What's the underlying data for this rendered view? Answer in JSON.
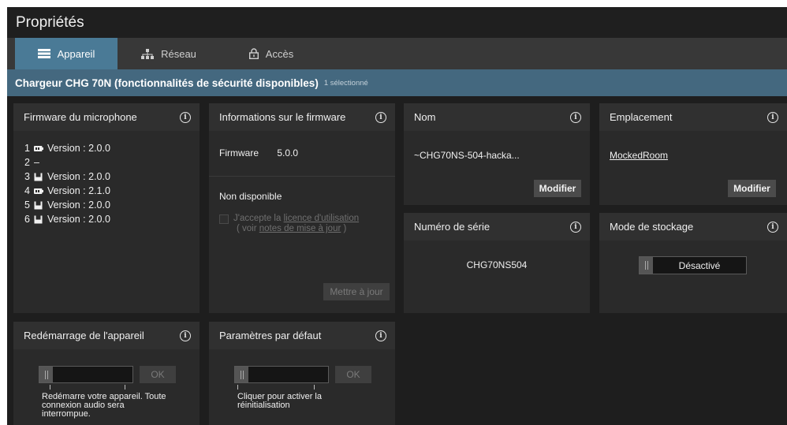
{
  "window": {
    "title": "Propriétés"
  },
  "tabs": [
    {
      "label": "Appareil",
      "icon": "device-icon",
      "active": true
    },
    {
      "label": "Réseau",
      "icon": "network-icon",
      "active": false
    },
    {
      "label": "Accès",
      "icon": "lock-icon",
      "active": false
    }
  ],
  "device": {
    "title": "Chargeur CHG 70N (fonctionnalités de sécurité disponibles)",
    "selected": "1 sélectionné"
  },
  "firmware_mic": {
    "title": "Firmware du microphone",
    "rows": [
      {
        "num": "1",
        "icon": "battery-pack-icon",
        "text": "Version : 2.0.0"
      },
      {
        "num": "2",
        "icon": "",
        "text": "–"
      },
      {
        "num": "3",
        "icon": "handheld-mic-icon",
        "text": "Version : 2.0.0"
      },
      {
        "num": "4",
        "icon": "battery-pack-icon",
        "text": "Version : 2.1.0"
      },
      {
        "num": "5",
        "icon": "handheld-mic-icon",
        "text": "Version : 2.0.0"
      },
      {
        "num": "6",
        "icon": "handheld-mic-icon",
        "text": "Version : 2.0.0"
      }
    ]
  },
  "firmware_info": {
    "title": "Informations sur le firmware",
    "label": "Firmware",
    "value": "5.0.0",
    "status": "Non disponible",
    "accept_prefix": "J'accepte la ",
    "accept_link": "licence d'utilisation",
    "notes_prefix": "( voir ",
    "notes_link": "notes de mise à jour",
    "notes_suffix": " )",
    "update_button": "Mettre à jour"
  },
  "name": {
    "title": "Nom",
    "value": "~CHG70NS-504-hacka...",
    "button": "Modifier"
  },
  "location": {
    "title": "Emplacement",
    "value": "MockedRoom",
    "button": "Modifier"
  },
  "serial": {
    "title": "Numéro de série",
    "value": "CHG70NS504"
  },
  "storage": {
    "title": "Mode de stockage",
    "state": "Désactivé"
  },
  "restart": {
    "title": "Redémarrage de l'appareil",
    "ok": "OK",
    "note": "Redémarre votre appareil. Toute connexion audio sera interrompue."
  },
  "defaults": {
    "title": "Paramètres par défaut",
    "ok": "OK",
    "note": "Cliquer pour activer la réinitialisation"
  },
  "colors": {
    "active_tab": "#4a7a96",
    "device_bar": "#44687f",
    "panel": "#2a2a2a",
    "background": "#1e1e1e"
  }
}
